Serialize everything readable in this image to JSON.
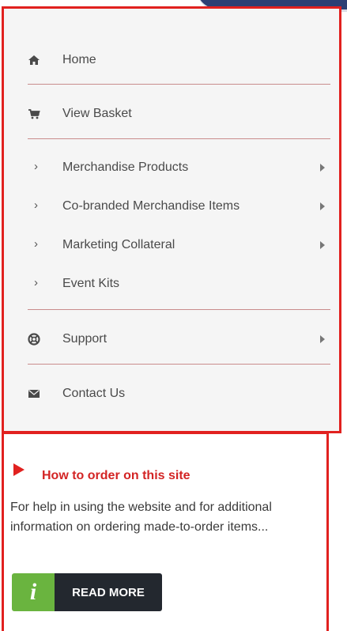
{
  "menu": {
    "items": [
      {
        "label": "Home",
        "icon": "home-icon"
      },
      {
        "label": "View Basket",
        "icon": "cart-icon"
      },
      {
        "label": "Merchandise Products",
        "icon": "chevron-right-icon",
        "has_submenu": true
      },
      {
        "label": "Co-branded Merchandise Items",
        "icon": "chevron-right-icon",
        "has_submenu": true
      },
      {
        "label": "Marketing Collateral",
        "icon": "chevron-right-icon",
        "has_submenu": true
      },
      {
        "label": "Event Kits",
        "icon": "chevron-right-icon",
        "has_submenu": false
      },
      {
        "label": "Support",
        "icon": "lifebuoy-icon",
        "has_submenu": true
      },
      {
        "label": "Contact Us",
        "icon": "envelope-icon"
      }
    ]
  },
  "info": {
    "title": "How to order on this site",
    "text": "For help in using the website and for additional information on ordering made-to-order items...",
    "button_label": "READ MORE",
    "button_icon_char": "i"
  },
  "colors": {
    "accent_red": "#e1211f",
    "button_green": "#6ab43f",
    "button_dark": "#23282f"
  }
}
